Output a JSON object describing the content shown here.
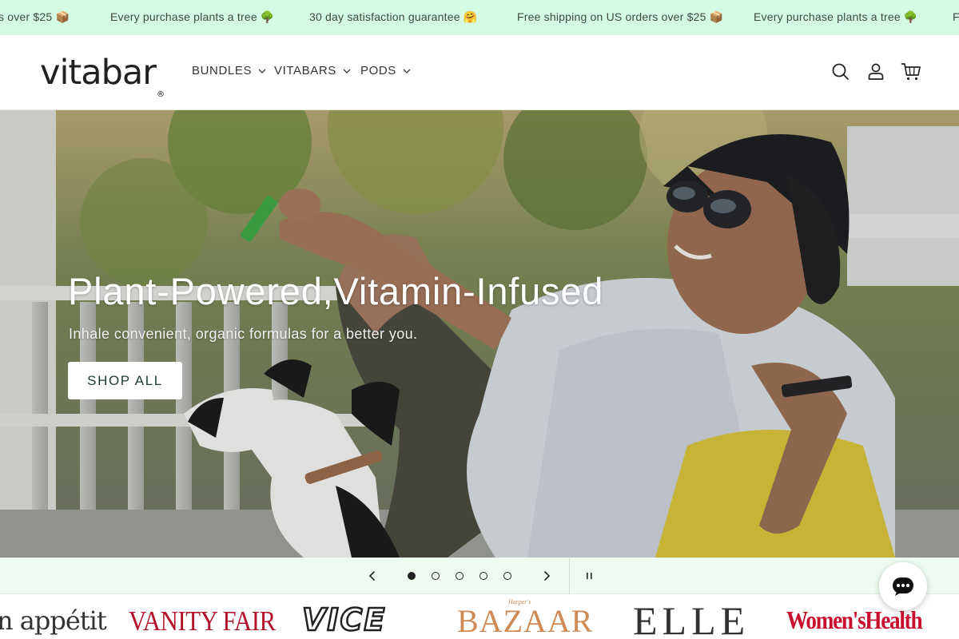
{
  "announcement": {
    "items": [
      "s over $25 📦",
      "Every purchase plants a tree 🌳",
      "30 day satisfaction guarantee 🤗",
      "Free shipping on US orders over $25 📦",
      "Every purchase plants a tree 🌳",
      "Fre"
    ]
  },
  "header": {
    "logo_text": "vitabar",
    "logo_mark": "®",
    "nav": [
      {
        "label": "BUNDLES"
      },
      {
        "label": "VITABARS"
      },
      {
        "label": "PODS"
      }
    ],
    "icons": [
      "search-icon",
      "account-icon",
      "cart-icon"
    ]
  },
  "hero": {
    "title": "Plant-Powered,Vitamin-Infused",
    "subtitle": "Inhale convenient, organic formulas for a better you.",
    "cta_label": "SHOP ALL"
  },
  "slider": {
    "slide_count": 5,
    "active_index": 0
  },
  "press": {
    "logos": [
      "n appétit",
      "VANITY FAIR",
      "VICE",
      "BAZAAR",
      "ELLE",
      "Women'sHealth"
    ],
    "bazaar_kicker": "Harper's"
  },
  "colors": {
    "announcement_bg": "#d4fbe2",
    "controls_bg": "#edfbf1",
    "cta_text": "#1e3b2c",
    "vanity_fair": "#b2122a",
    "bazaar": "#cf8a54",
    "womens_health": "#c8102e"
  }
}
